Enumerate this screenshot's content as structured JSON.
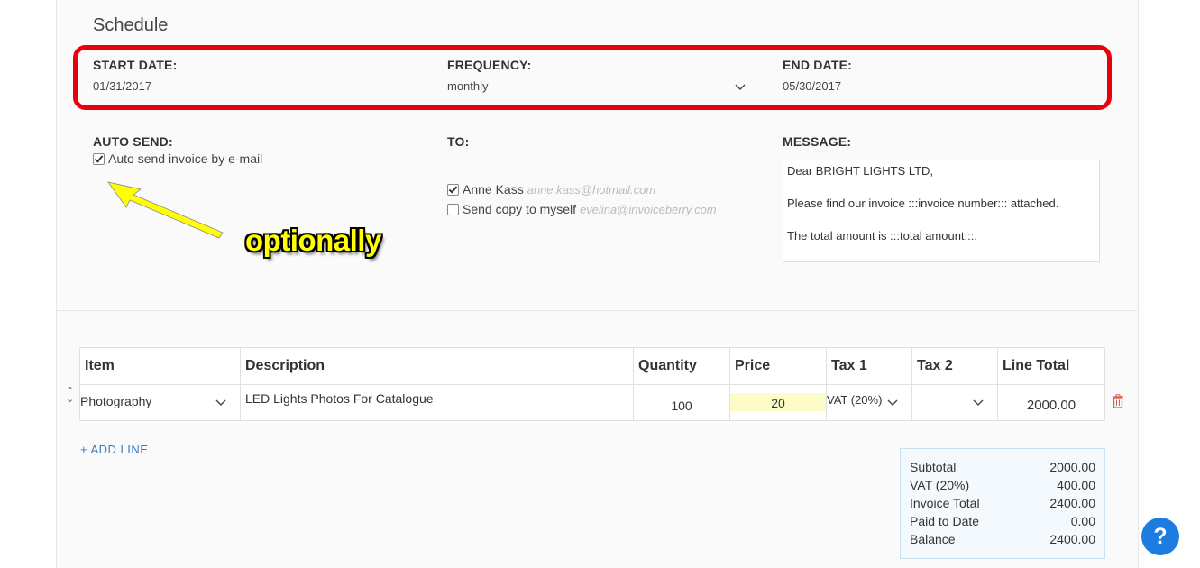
{
  "schedule": {
    "title": "Schedule",
    "start_date_label": "START DATE:",
    "start_date_value": "01/31/2017",
    "frequency_label": "FREQUENCY:",
    "frequency_value": "monthly",
    "end_date_label": "END DATE:",
    "end_date_value": "05/30/2017"
  },
  "auto_send": {
    "label": "AUTO SEND:",
    "checkbox_label": "Auto send invoice by e-mail",
    "checked": true
  },
  "to": {
    "label": "TO:",
    "recipients": [
      {
        "name": "Anne Kass",
        "email": "anne.kass@hotmail.com",
        "checked": true
      },
      {
        "name": "Send copy to myself",
        "email": "evelina@invoiceberry.com",
        "checked": false
      }
    ]
  },
  "message": {
    "label": "MESSAGE:",
    "lines": [
      "Dear BRIGHT LIGHTS LTD,",
      "Please find our invoice :::invoice number::: attached.",
      "The total amount is :::total amount:::."
    ]
  },
  "annotation": {
    "text": "optionally",
    "highlight_color": "#e8000b",
    "arrow_color": "#ffff00"
  },
  "items_table": {
    "headers": [
      "Item",
      "Description",
      "Quantity",
      "Price",
      "Tax 1",
      "Tax 2",
      "Line Total"
    ],
    "rows": [
      {
        "item": "Photography",
        "description": "LED Lights  Photos For Catalogue",
        "quantity": "100",
        "price": "20",
        "tax1": "VAT (20%)",
        "tax2": "",
        "line_total": "2000.00"
      }
    ],
    "add_line_label": "+ ADD LINE"
  },
  "totals": [
    {
      "label": "Subtotal",
      "value": "2000.00"
    },
    {
      "label": "VAT (20%)",
      "value": "400.00"
    },
    {
      "label": "Invoice Total",
      "value": "2400.00"
    },
    {
      "label": "Paid to Date",
      "value": "0.00"
    },
    {
      "label": "Balance",
      "value": "2400.00"
    }
  ],
  "help": {
    "label": "?",
    "color": "#1e7be0"
  }
}
